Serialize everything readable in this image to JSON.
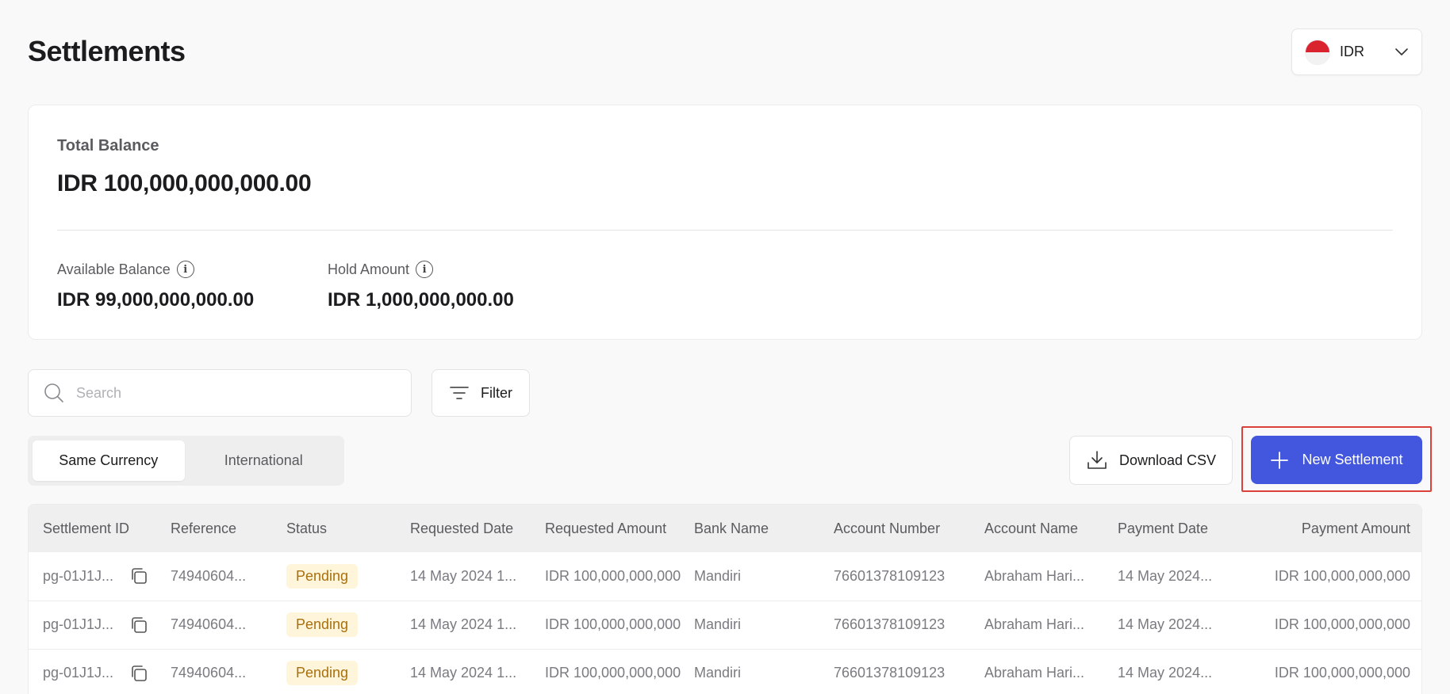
{
  "page": {
    "title": "Settlements"
  },
  "currency": {
    "code": "IDR",
    "flag_icon": "indonesia-flag-icon"
  },
  "balance": {
    "total_label": "Total Balance",
    "total_value": "IDR 100,000,000,000.00",
    "available_label": "Available Balance",
    "available_value": "IDR 99,000,000,000.00",
    "hold_label": "Hold Amount",
    "hold_value": "IDR 1,000,000,000.00"
  },
  "search": {
    "placeholder": "Search",
    "value": ""
  },
  "filter": {
    "label": "Filter"
  },
  "tabs": [
    {
      "label": "Same Currency",
      "active": true
    },
    {
      "label": "International",
      "active": false
    }
  ],
  "actions": {
    "download_label": "Download CSV",
    "new_settlement_label": "New Settlement"
  },
  "colors": {
    "primary": "#4257dd",
    "highlight": "#d9413a",
    "pending_bg": "#fff5da",
    "pending_text": "#a8700e"
  },
  "table": {
    "columns": [
      "Settlement ID",
      "Reference",
      "Status",
      "Requested Date",
      "Requested Amount",
      "Bank Name",
      "Account Number",
      "Account Name",
      "Payment Date",
      "Payment Amount"
    ],
    "rows": [
      {
        "settlement_id": "pg-01J1J...",
        "reference": "74940604...",
        "status": "Pending",
        "requested_date": "14 May 2024 1...",
        "requested_amount": "IDR 100,000,000,000",
        "bank_name": "Mandiri",
        "account_number": "76601378109123",
        "account_name": "Abraham Hari...",
        "payment_date": "14 May 2024...",
        "payment_amount": "IDR 100,000,000,000"
      },
      {
        "settlement_id": "pg-01J1J...",
        "reference": "74940604...",
        "status": "Pending",
        "requested_date": "14 May 2024 1...",
        "requested_amount": "IDR 100,000,000,000",
        "bank_name": "Mandiri",
        "account_number": "76601378109123",
        "account_name": "Abraham Hari...",
        "payment_date": "14 May 2024...",
        "payment_amount": "IDR 100,000,000,000"
      },
      {
        "settlement_id": "pg-01J1J...",
        "reference": "74940604...",
        "status": "Pending",
        "requested_date": "14 May 2024 1...",
        "requested_amount": "IDR 100,000,000,000",
        "bank_name": "Mandiri",
        "account_number": "76601378109123",
        "account_name": "Abraham Hari...",
        "payment_date": "14 May 2024...",
        "payment_amount": "IDR 100,000,000,000"
      }
    ]
  }
}
